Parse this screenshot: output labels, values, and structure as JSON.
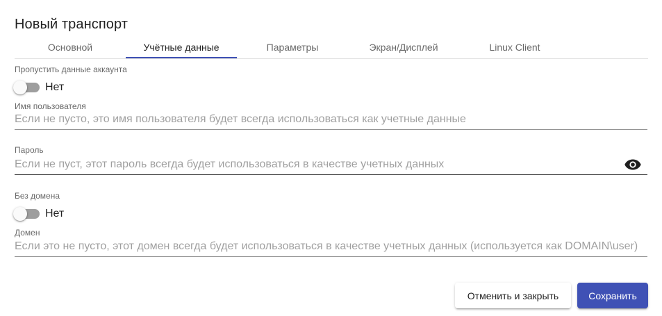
{
  "dialog": {
    "title": "Новый транспорт"
  },
  "tabs": [
    {
      "label": "Основной",
      "active": false
    },
    {
      "label": "Учётные данные",
      "active": true
    },
    {
      "label": "Параметры",
      "active": false
    },
    {
      "label": "Экран/Дисплей",
      "active": false
    },
    {
      "label": "Linux Client",
      "active": false
    }
  ],
  "form": {
    "skip_account": {
      "label": "Пропустить данные аккаунта",
      "value_text": "Нет",
      "checked": false
    },
    "username": {
      "label": "Имя пользователя",
      "value": "",
      "placeholder": "Если не пусто, это имя пользователя будет всегда использоваться как учетные данные"
    },
    "password": {
      "label": "Пароль",
      "value": "",
      "placeholder": "Если не пуст, этот пароль всегда будет использоваться в качестве учетных данных",
      "icon": "eye-icon"
    },
    "no_domain": {
      "label": "Без домена",
      "value_text": "Нет",
      "checked": false
    },
    "domain": {
      "label": "Домен",
      "value": "",
      "placeholder": "Если это не пусто, этот домен всегда будет использоваться в качестве учетных данных (используется как DOMAIN\\user)"
    }
  },
  "actions": {
    "cancel_label": "Отменить и закрыть",
    "save_label": "Сохранить"
  },
  "colors": {
    "primary": "#3f51b5",
    "toggle_track": "#9e9e9e",
    "toggle_thumb": "#fafafa"
  }
}
